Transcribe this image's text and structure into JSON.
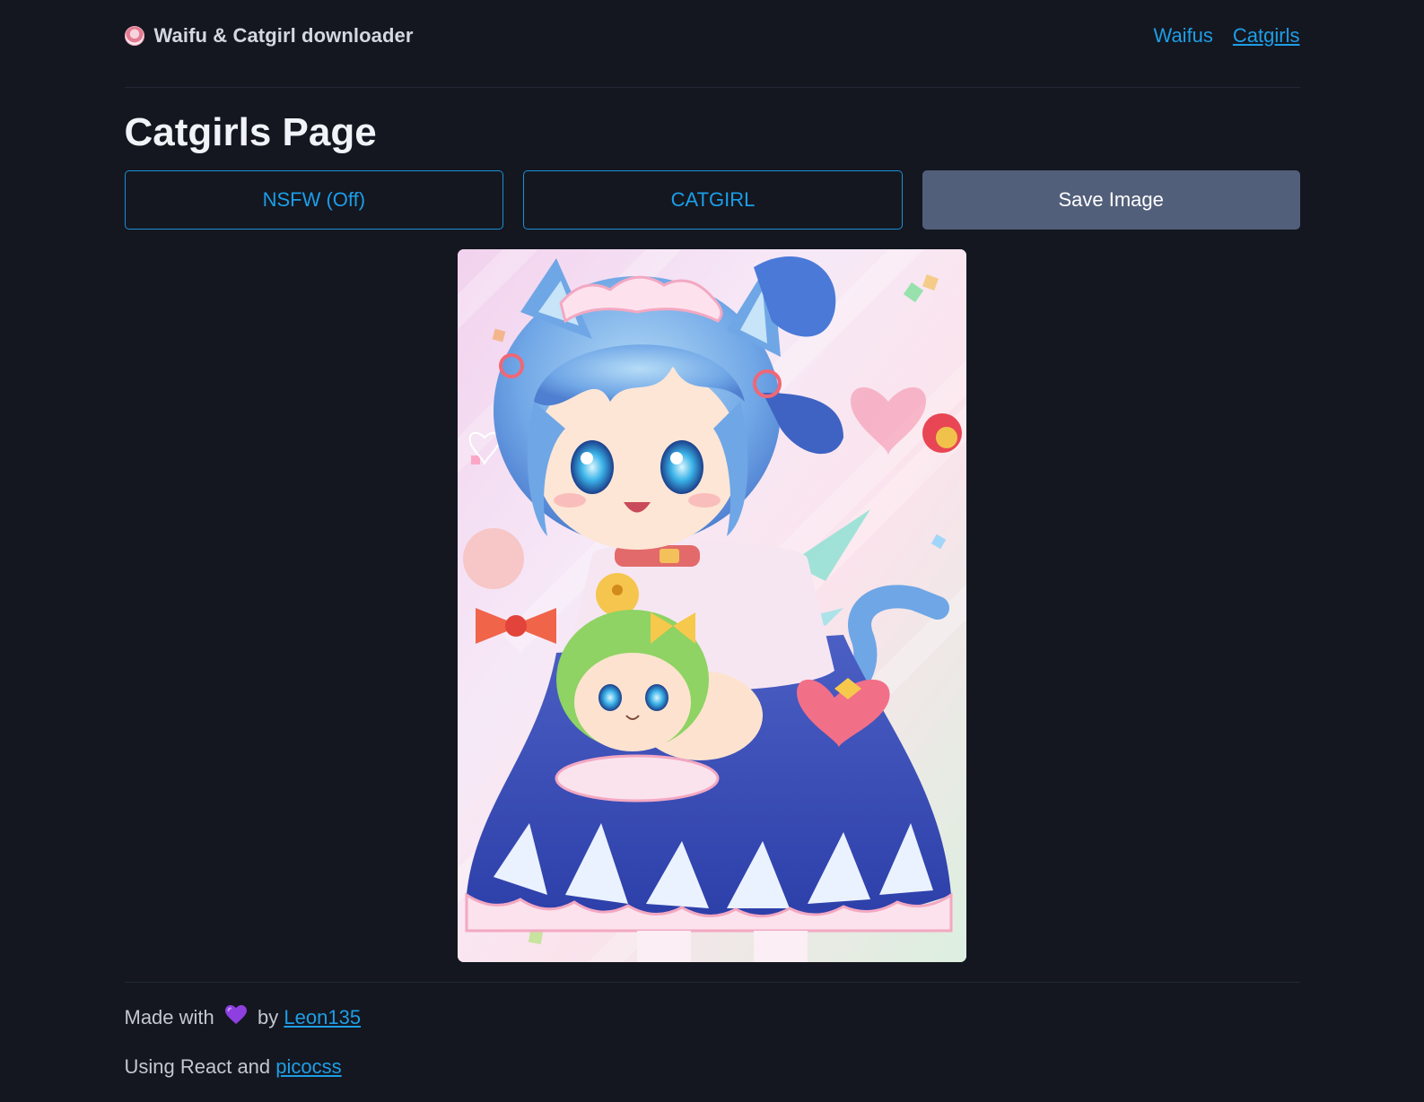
{
  "header": {
    "brand_title": "Waifu & Catgirl downloader",
    "nav": [
      {
        "label": "Waifus",
        "active": false
      },
      {
        "label": "Catgirls",
        "active": true
      }
    ]
  },
  "main": {
    "title": "Catgirls Page",
    "buttons": {
      "nsfw_label": "NSFW (Off)",
      "category_label": "CATGIRL",
      "save_label": "Save Image"
    }
  },
  "footer": {
    "made_with_prefix": "Made with",
    "by_text": "by",
    "author_link": "Leon135",
    "using_text": "Using React and",
    "framework_link": "picocss"
  },
  "colors": {
    "background": "#141720",
    "link": "#1e9ee6",
    "outline_button": "#1a8fd4",
    "secondary_button": "#525f7a",
    "heart": "#8e3fe0"
  },
  "icons": {
    "logo": "round-avatar-logo",
    "heart": "purple-heart-icon"
  }
}
